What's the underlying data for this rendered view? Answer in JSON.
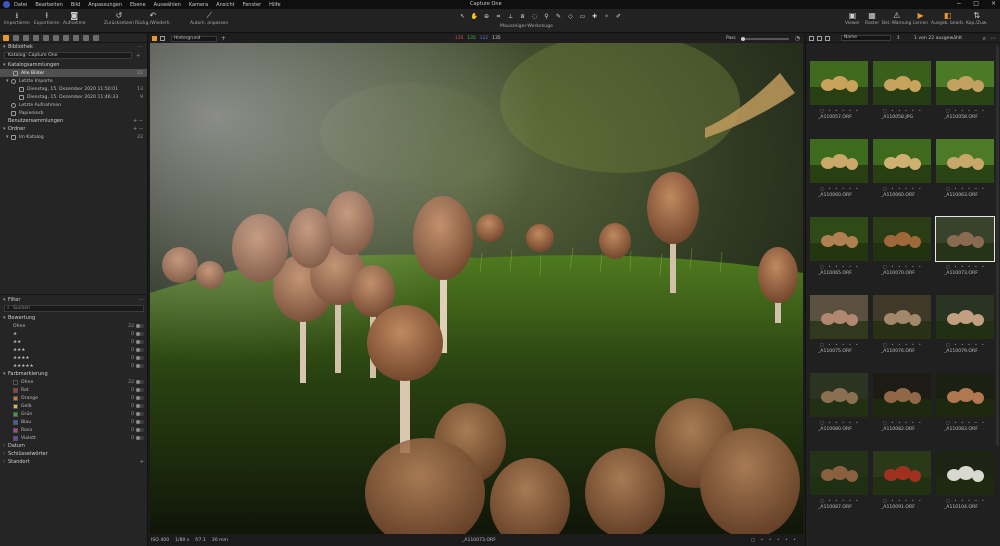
{
  "menubar": {
    "items": [
      "Datei",
      "Bearbeiten",
      "Bild",
      "Anpassungen",
      "Ebene",
      "Auswählen",
      "Kamera",
      "Ansicht",
      "Fenster",
      "Hilfe"
    ],
    "title": "Capture One",
    "controls": [
      "−",
      "□",
      "×"
    ]
  },
  "toolbar": {
    "import": "Importieren",
    "export": "Exportieren",
    "capture": "Aufnahme",
    "reset": "Zurücksetzen",
    "undo_redo": "Rückg./Wiederh.",
    "auto_adjust": "Autom. anpassen",
    "cursor_tools_label": "Mauszeiger-Werkzeuge",
    "viewer": "Viewer",
    "grid": "Raster",
    "exposure_warning": "Bel.-Warnung",
    "learn": "Lernen",
    "edit_output": "Ausgeb. bearb.",
    "copy_apply": "Kop./Zuw."
  },
  "library": {
    "title": "Bibliothek",
    "catalog": "Katalog: Capture One",
    "catalog_collections": "Katalogsammlungen",
    "all_images": "Alle Bilder",
    "all_images_count": "22",
    "recent_imports": "Letzte Importe",
    "import1": "Dienstag, 15. Dezember 2020 11:50:01",
    "import1_count": "13",
    "import2": "Dienstag, 15. Dezember 2020 11:46:33",
    "import2_count": "9",
    "recent_captures": "Letzte Aufnahmen",
    "trash": "Papierkorb",
    "user_collections": "Benutzersammlungen",
    "folders": "Ordner",
    "in_catalog": "Im Katalog",
    "in_catalog_count": "22"
  },
  "filters": {
    "title": "Filter",
    "search_placeholder": "Suchen",
    "rating_title": "Bewertung",
    "ratings": [
      {
        "label": "Ohne",
        "count": "22"
      },
      {
        "label": "★",
        "count": "0"
      },
      {
        "label": "★★",
        "count": "0"
      },
      {
        "label": "★★★",
        "count": "0"
      },
      {
        "label": "★★★★",
        "count": "0"
      },
      {
        "label": "★★★★★",
        "count": "0"
      }
    ],
    "color_title": "Farbmarkierung",
    "colors": [
      {
        "label": "Ohne",
        "count": "22",
        "color": "#222222"
      },
      {
        "label": "Rot",
        "count": "0",
        "color": "#c0282a"
      },
      {
        "label": "Orange",
        "count": "0",
        "color": "#d9781f"
      },
      {
        "label": "Gelb",
        "count": "0",
        "color": "#d8c21f"
      },
      {
        "label": "Grün",
        "count": "0",
        "color": "#3aa43a"
      },
      {
        "label": "Blau",
        "count": "0",
        "color": "#2f5fd0"
      },
      {
        "label": "Rosa",
        "count": "0",
        "color": "#c43a9a"
      },
      {
        "label": "Violett",
        "count": "0",
        "color": "#7a3ac4"
      }
    ],
    "date": "Datum",
    "keywords": "Schlüsselwörter",
    "location": "Standort"
  },
  "viewer": {
    "layer": "Hintergrund",
    "rgb_r": "135",
    "rgb_g": "135",
    "rgb_b": "122",
    "rgb_a": "135",
    "fit": "Pass",
    "iso": "ISO 400",
    "shutter": "1/80 s",
    "aperture": "f/7.1",
    "focal": "30 mm",
    "filename": "_A110073.ORF"
  },
  "browser": {
    "sort": "Name",
    "count": "1 von 22 ausgewählt",
    "thumbs": [
      {
        "name": "_A110057.ORF"
      },
      {
        "name": "_A110058.JPG"
      },
      {
        "name": "_A110058.ORF"
      },
      {
        "name": "_A110060.ORF"
      },
      {
        "name": "_A110060.ORF"
      },
      {
        "name": "_A110063.ORF"
      },
      {
        "name": "_A110065.ORF"
      },
      {
        "name": "_A110070.ORF"
      },
      {
        "name": "_A110073.ORF"
      },
      {
        "name": "_A110075.ORF"
      },
      {
        "name": "_A110076.ORF"
      },
      {
        "name": "_A110079.ORF"
      },
      {
        "name": "_A110080.ORF"
      },
      {
        "name": "_A110082.ORF"
      },
      {
        "name": "_A110083.ORF"
      },
      {
        "name": "_A110087.ORF"
      },
      {
        "name": "_A110091.ORF"
      },
      {
        "name": "_A110104.ORF"
      }
    ],
    "selected_index": 8,
    "star_row": "□ • • • • •"
  }
}
